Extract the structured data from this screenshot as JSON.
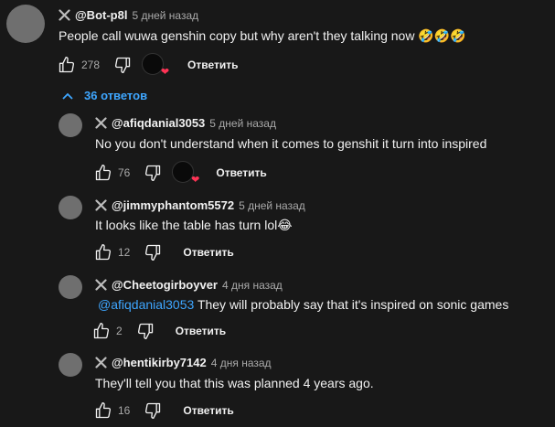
{
  "icons": {
    "remove": "x-icon",
    "like": "thumb-up-icon",
    "dislike": "thumb-down-icon",
    "heart": "heart-icon",
    "chevron": "chevron-up-icon"
  },
  "colors": {
    "background": "#181818",
    "link": "#3ea6ff",
    "heart": "#ff3355",
    "muted": "#aaaaaa"
  },
  "top_comment": {
    "author": "@Bot-p8l",
    "time": "5 дней назад",
    "text": "People call wuwa genshin copy but why aren't they talking now 🤣🤣🤣",
    "likes": "278",
    "reply_label": "Ответить",
    "hearted": true
  },
  "replies_toggle": {
    "label": "36 ответов"
  },
  "replies": [
    {
      "author": "@afiqdanial3053",
      "time": "5 дней назад",
      "mention": "",
      "text": "No you don't understand when it comes to genshit it turn into inspired",
      "likes": "76",
      "reply_label": "Ответить",
      "hearted": true
    },
    {
      "author": "@jimmyphantom5572",
      "time": "5 дней назад",
      "mention": "",
      "text": "It looks like the table has turn lol😂",
      "likes": "12",
      "reply_label": "Ответить",
      "hearted": false
    },
    {
      "author": "@Cheetogirboyver",
      "time": "4 дня назад",
      "mention": "@afiqdanial3053",
      "text": "They will probably say that it's inspired on sonic games",
      "likes": "2",
      "reply_label": "Ответить",
      "hearted": false
    },
    {
      "author": "@hentikirby7142",
      "time": "4 дня назад",
      "mention": "",
      "text": "They'll tell you that this was planned 4 years ago.",
      "likes": "16",
      "reply_label": "Ответить",
      "hearted": false
    }
  ]
}
